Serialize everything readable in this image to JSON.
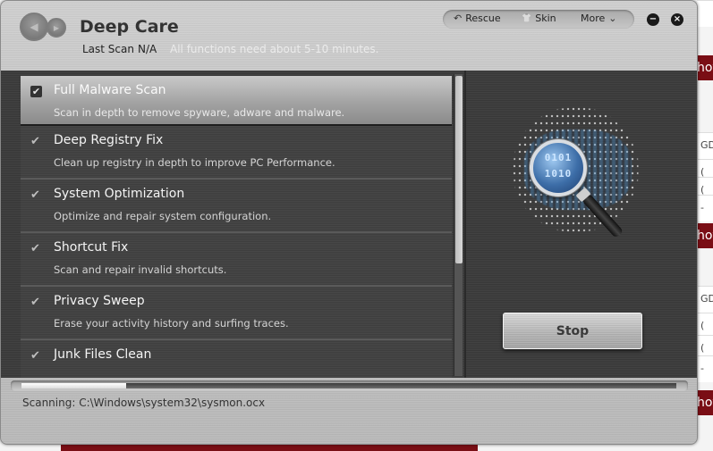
{
  "background": {
    "strip_texts": [
      "hot",
      "hot",
      "hot"
    ],
    "cells": [
      "GD",
      "-",
      "(",
      "(",
      "-",
      "GD",
      "(",
      "(",
      "-"
    ]
  },
  "app": {
    "title": "Deep Care",
    "last_scan_label": "Last Scan",
    "last_scan_value": "N/A",
    "scan_hint": "All functions need about 5-10 minutes."
  },
  "nav": {
    "back_icon": "◀",
    "forward_icon": "▶"
  },
  "toolbar": {
    "rescue_label": "Rescue",
    "rescue_icon": "↶",
    "skin_label": "Skin",
    "skin_icon": "👕",
    "more_label": "More",
    "more_icon": "⌄"
  },
  "window_controls": {
    "minimize_icon": "−",
    "close_icon": "×"
  },
  "tasks": [
    {
      "title": "Full Malware Scan",
      "desc": "Scan in depth to remove spyware, adware and malware.",
      "checked": true,
      "active": true
    },
    {
      "title": "Deep Registry Fix",
      "desc": "Clean up registry in depth to improve PC Performance.",
      "checked": true,
      "active": false
    },
    {
      "title": "System Optimization",
      "desc": "Optimize and repair system configuration.",
      "checked": true,
      "active": false
    },
    {
      "title": "Shortcut Fix",
      "desc": "Scan and repair invalid shortcuts.",
      "checked": true,
      "active": false
    },
    {
      "title": "Privacy Sweep",
      "desc": "Erase your activity history and surfing traces.",
      "checked": true,
      "active": false
    },
    {
      "title": "Junk Files Clean",
      "desc": "",
      "checked": true,
      "active": false
    }
  ],
  "check_glyph": "✔",
  "graphic": {
    "lens_text": "0101\n1010"
  },
  "stop_button_label": "Stop",
  "progress": {
    "percent": 16
  },
  "scan_status": "Scanning: C:\\Windows\\system32\\sysmon.ocx"
}
